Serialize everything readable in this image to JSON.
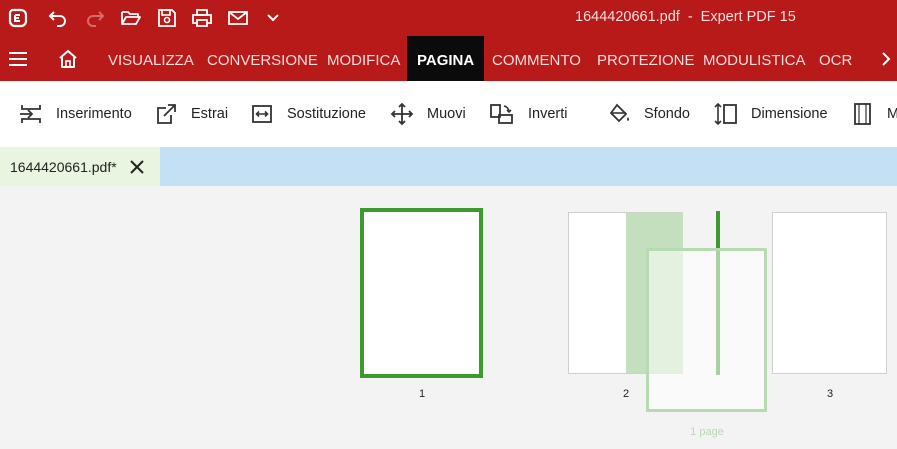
{
  "app": {
    "filename": "1644420661.pdf",
    "separator": "-",
    "name": "Expert PDF 15"
  },
  "quick_access": [
    "app-logo-icon",
    "undo-icon",
    "redo-icon",
    "open-folder-icon",
    "save-icon",
    "print-icon",
    "email-icon",
    "customize-dropdown-icon"
  ],
  "menu": {
    "items": [
      "VISUALIZZA",
      "CONVERSIONE",
      "MODIFICA",
      "PAGINA",
      "COMMENTO",
      "PROTEZIONE",
      "MODULISTICA",
      "OCR"
    ],
    "active": "PAGINA"
  },
  "toolbar": {
    "tools": [
      "Inserimento",
      "Estrai",
      "Sostituzione",
      "Muovi",
      "Inverti",
      "Sfondo",
      "Dimensione",
      "M"
    ]
  },
  "document_tab": {
    "label": "1644420661.pdf*"
  },
  "pages": [
    {
      "number": "1",
      "selected": true
    },
    {
      "number": "2",
      "selected": false
    },
    {
      "number": "3",
      "selected": false
    }
  ],
  "drag_preview": {
    "label": "1 page"
  },
  "colors": {
    "brand_red": "#b81a1a",
    "active_tab": "#0b0b0b",
    "selection_green": "#3c9a2e",
    "tab_strip_blue": "#c4e0f5",
    "doc_tab_green": "#e9f5e0"
  }
}
